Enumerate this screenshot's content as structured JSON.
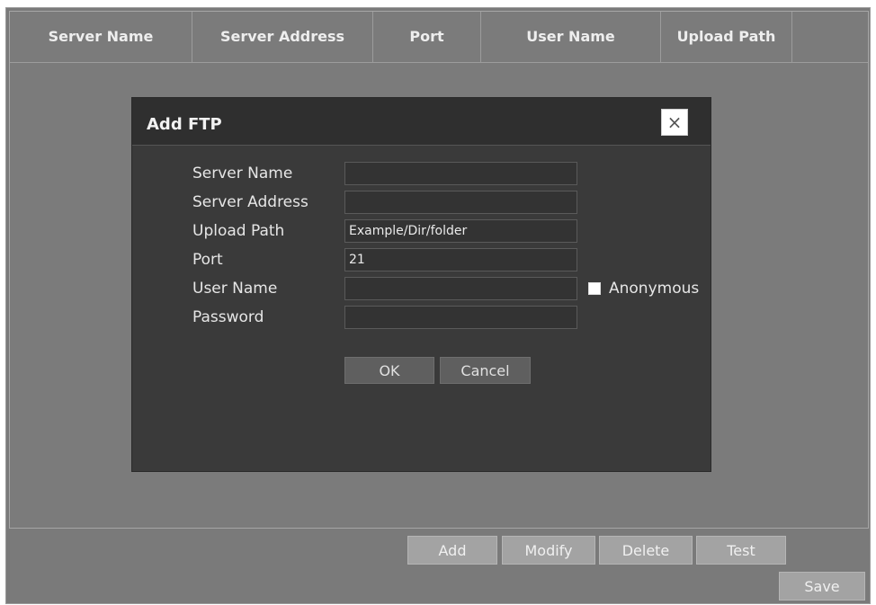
{
  "table": {
    "columns": [
      "Server Name",
      "Server Address",
      "Port",
      "User Name",
      "Upload Path"
    ]
  },
  "toolbar": {
    "add_label": "Add",
    "modify_label": "Modify",
    "delete_label": "Delete",
    "test_label": "Test",
    "save_label": "Save"
  },
  "dialog": {
    "title": "Add FTP",
    "close_glyph": "×",
    "fields": {
      "server_name": {
        "label": "Server Name",
        "value": ""
      },
      "server_address": {
        "label": "Server Address",
        "value": ""
      },
      "upload_path": {
        "label": "Upload Path",
        "value": "Example/Dir/folder"
      },
      "port": {
        "label": "Port",
        "value": "21"
      },
      "user_name": {
        "label": "User Name",
        "value": ""
      },
      "password": {
        "label": "Password",
        "value": ""
      }
    },
    "anonymous_label": "Anonymous",
    "anonymous_checked": false,
    "ok_label": "OK",
    "cancel_label": "Cancel"
  }
}
